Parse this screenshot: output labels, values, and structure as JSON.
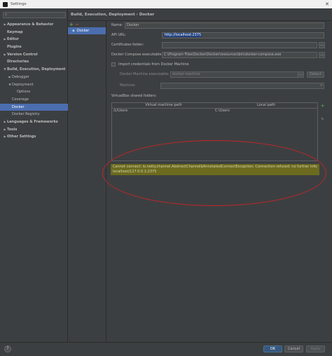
{
  "window": {
    "title": "Settings"
  },
  "search": {
    "placeholder": ""
  },
  "tree": [
    {
      "label": "Appearance & Behavior",
      "arrow": "▶",
      "bold": true,
      "indent": 0
    },
    {
      "label": "Keymap",
      "arrow": "",
      "bold": true,
      "indent": 0
    },
    {
      "label": "Editor",
      "arrow": "▶",
      "bold": true,
      "indent": 0
    },
    {
      "label": "Plugins",
      "arrow": "",
      "bold": true,
      "indent": 0
    },
    {
      "label": "Version Control",
      "arrow": "▶",
      "bold": true,
      "indent": 0
    },
    {
      "label": "Directories",
      "arrow": "",
      "bold": true,
      "indent": 0
    },
    {
      "label": "Build, Execution, Deployment",
      "arrow": "▼",
      "bold": true,
      "indent": 0
    },
    {
      "label": "Debugger",
      "arrow": "▶",
      "bold": false,
      "indent": 1
    },
    {
      "label": "Deployment",
      "arrow": "▼",
      "bold": false,
      "indent": 1
    },
    {
      "label": "Options",
      "arrow": "",
      "bold": false,
      "indent": 2
    },
    {
      "label": "Coverage",
      "arrow": "",
      "bold": false,
      "indent": 1
    },
    {
      "label": "Docker",
      "arrow": "",
      "bold": false,
      "indent": 1,
      "selected": true
    },
    {
      "label": "Docker Registry",
      "arrow": "",
      "bold": false,
      "indent": 1
    },
    {
      "label": "Languages & Frameworks",
      "arrow": "▶",
      "bold": true,
      "indent": 0
    },
    {
      "label": "Tools",
      "arrow": "▶",
      "bold": true,
      "indent": 0
    },
    {
      "label": "Other Settings",
      "arrow": "▶",
      "bold": true,
      "indent": 0
    }
  ],
  "breadcrumb": "Build, Execution, Deployment › Docker",
  "servers": {
    "add_glyph": "+",
    "remove_glyph": "−",
    "items": [
      {
        "label": "Docker"
      }
    ]
  },
  "form": {
    "name_label": "Name:",
    "name_value": "Docker",
    "api_url_label": "API URL:",
    "api_url_value": "http://localhost:2375",
    "cert_label": "Certificates folder:",
    "cert_value": "",
    "compose_label": "Docker Compose executable:",
    "compose_value": "C:\\Program Files\\Docker\\Docker\\resources\\bin\\docker-compose.exe",
    "browse_glyph": "...",
    "import_label": "Import credentials from Docker Machine",
    "machine_exec_label": "Docker Machine executable:",
    "machine_exec_value": "docker-machine",
    "detect_label": "Detect",
    "machine_label": "Machine:",
    "vbox_label": "VirtualBox shared folders:"
  },
  "vbox_table": {
    "columns": [
      "Virtual machine path",
      "Local path"
    ],
    "rows": [
      [
        "/c/Users",
        "C:\\Users"
      ]
    ]
  },
  "error": {
    "line1": "Cannot connect: io.netty.channel.AbstractChannel$AnnotatedConnectException: Connection refused: no further information:",
    "line2": "localhost/127.0.0.1:2375"
  },
  "footer": {
    "help_glyph": "?",
    "ok_label": "OK",
    "cancel_label": "Cancel",
    "apply_label": "Apply"
  },
  "colors": {
    "accent_selected": "#4b6eaf",
    "error_band": "#6b6a1f",
    "annotation_red": "#c0262a",
    "add_green": "#59a869"
  }
}
